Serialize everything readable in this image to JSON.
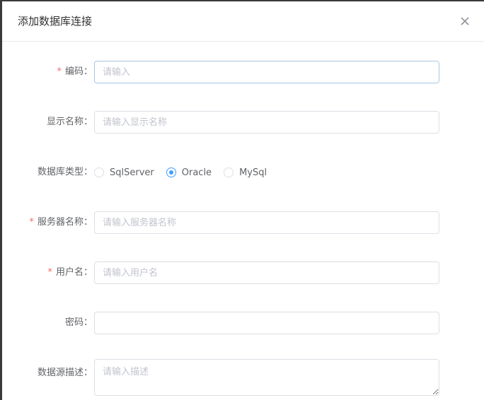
{
  "dialog": {
    "title": "添加数据库连接",
    "close_icon": "close-icon"
  },
  "form": {
    "code": {
      "label": "编码：",
      "required": "*",
      "placeholder": "请输入",
      "value": ""
    },
    "display_name": {
      "label": "显示名称：",
      "placeholder": "请输入显示名称",
      "value": ""
    },
    "db_type": {
      "label": "数据库类型：",
      "options": [
        "SqlServer",
        "Oracle",
        "MySql"
      ],
      "selected": "Oracle"
    },
    "server_name": {
      "label": "服务器名称：",
      "required": "*",
      "placeholder": "请输入服务器名称",
      "value": ""
    },
    "username": {
      "label": "用户名：",
      "required": "*",
      "placeholder": "请输入用户名",
      "value": ""
    },
    "password": {
      "label": "密码：",
      "placeholder": "",
      "value": ""
    },
    "description": {
      "label": "数据源描述：",
      "placeholder": "请输入描述",
      "value": ""
    }
  },
  "colors": {
    "accent": "#409eff",
    "required": "#f56c6c",
    "border": "#dcdfe6",
    "label": "#606266",
    "placeholder": "#c0c4cc"
  }
}
